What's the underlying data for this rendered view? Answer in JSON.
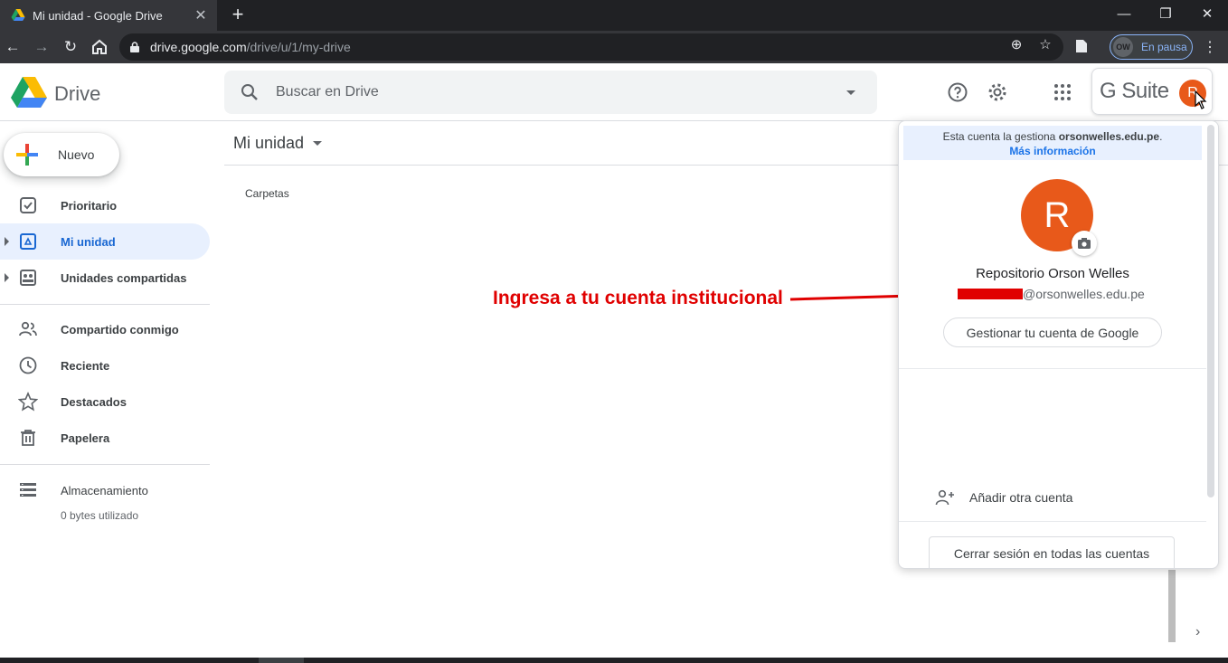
{
  "browser": {
    "tab_title": "Mi unidad - Google Drive",
    "url_host": "drive.google.com",
    "url_path": "/drive/u/1/my-drive",
    "profile_label": "En pausa",
    "profile_initials": "OW"
  },
  "header": {
    "brand": "Drive",
    "search_placeholder": "Buscar en Drive",
    "gsuite_label": "G Suite",
    "avatar_initial": "R"
  },
  "sidebar": {
    "new_label": "Nuevo",
    "items": [
      {
        "label": "Prioritario",
        "icon": "priority-icon"
      },
      {
        "label": "Mi unidad",
        "icon": "drive-icon"
      },
      {
        "label": "Unidades compartidas",
        "icon": "shared-drives-icon"
      },
      {
        "label": "Compartido conmigo",
        "icon": "people-icon"
      },
      {
        "label": "Reciente",
        "icon": "clock-icon"
      },
      {
        "label": "Destacados",
        "icon": "star-icon"
      },
      {
        "label": "Papelera",
        "icon": "trash-icon"
      },
      {
        "label": "Almacenamiento",
        "icon": "storage-icon"
      }
    ],
    "storage_used": "0 bytes utilizado"
  },
  "main": {
    "breadcrumb": "Mi unidad",
    "section_label": "Carpetas",
    "annotation": "Ingresa a tu cuenta institucional"
  },
  "account_popup": {
    "managed_prefix": "Esta cuenta la gestiona ",
    "managed_domain": "orsonwelles.edu.pe",
    "managed_suffix": ".",
    "more_info": "Más información",
    "avatar_initial": "R",
    "name": "Repositorio Orson Welles",
    "email_domain": "@orsonwelles.edu.pe",
    "manage_button": "Gestionar tu cuenta de Google",
    "add_account": "Añadir otra cuenta",
    "sign_out": "Cerrar sesión en todas las cuentas"
  },
  "colors": {
    "accent": "#1a73e8",
    "active_bg": "#e8f0fe",
    "avatar": "#e8591a",
    "annotation": "#e00000"
  }
}
